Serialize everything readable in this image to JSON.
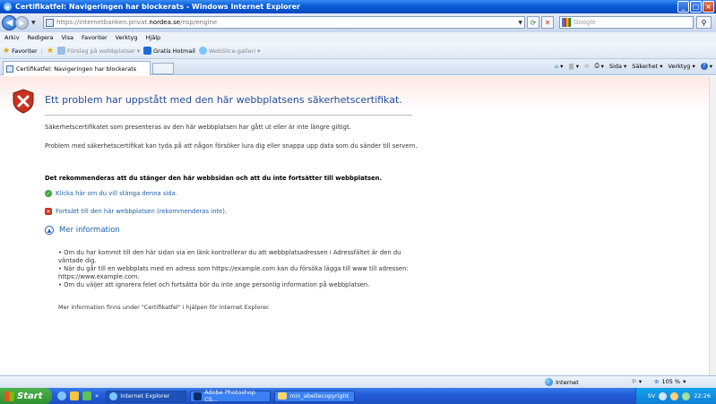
{
  "window": {
    "title": "Certifikatfel: Navigeringen har blockerats - Windows Internet Explorer",
    "min": "_",
    "max": "□",
    "close": "×"
  },
  "address": {
    "url_prefix": "https://internetbanken.privat.",
    "url_domain": "nordea.se",
    "url_suffix": "/nsp/engine",
    "search_placeholder": "Google"
  },
  "menu": [
    "Arkiv",
    "Redigera",
    "Visa",
    "Favoriter",
    "Verktyg",
    "Hjälp"
  ],
  "favorites": {
    "label": "Favoriter",
    "items": [
      "Förslag på webbplatser ▾",
      "Gratis Hotmail",
      "WebSlice-galleri ▾"
    ]
  },
  "tab": {
    "title": "Certifikatfel: Navigeringen har blockerats"
  },
  "commandbar": [
    "Sida ▾",
    "Säkerhet ▾",
    "Verktyg ▾"
  ],
  "content": {
    "heading": "Ett problem har uppstått med den här webbplatsens säkerhetscertifikat.",
    "p1": "Säkerhetscertifikatet som presenteras av den här webbplatsen har gått ut eller är inte längre giltigt.",
    "p2": "Problem med säkerhetscertifikat kan tyda på att någon försöker lura dig eller snappa upp data som du sänder till servern.",
    "p3": "Det rekommenderas att du stänger den här webbsidan och att du inte fortsätter till webbplatsen.",
    "link_close": "Klicka här om du vill stänga denna sida.",
    "link_continue": "Fortsätt till den här webbplatsen (rekommenderas inte).",
    "more_info": "Mer information",
    "bullets": [
      "Om du har kommit till den här sidan via en länk kontrollerar du att webbplatsadressen i Adressfältet är den du väntade dig.",
      "När du går till en webbplats med en adress som https://example.com kan du försöka lägga till www till adressen: https://www.example.com.",
      "Om du väljer att ignorera felet och fortsätta bör du inte ange personlig information på webbplatsen."
    ],
    "footer": "Mer information finns under \"Certifikatfel\" i hjälpen för Internet Explorer."
  },
  "status": {
    "zone": "Internet",
    "zoom": "105 %"
  },
  "taskbar": {
    "start": "Start",
    "tasks": [
      "Internet Explorer",
      "Adobe Photoshop CS...",
      "min_abellecopyright"
    ],
    "lang": "SV",
    "clock": "22:26"
  },
  "colors": {
    "heading": "#1f4e9b",
    "link": "#1f5fa8",
    "error": "#c8321e"
  }
}
